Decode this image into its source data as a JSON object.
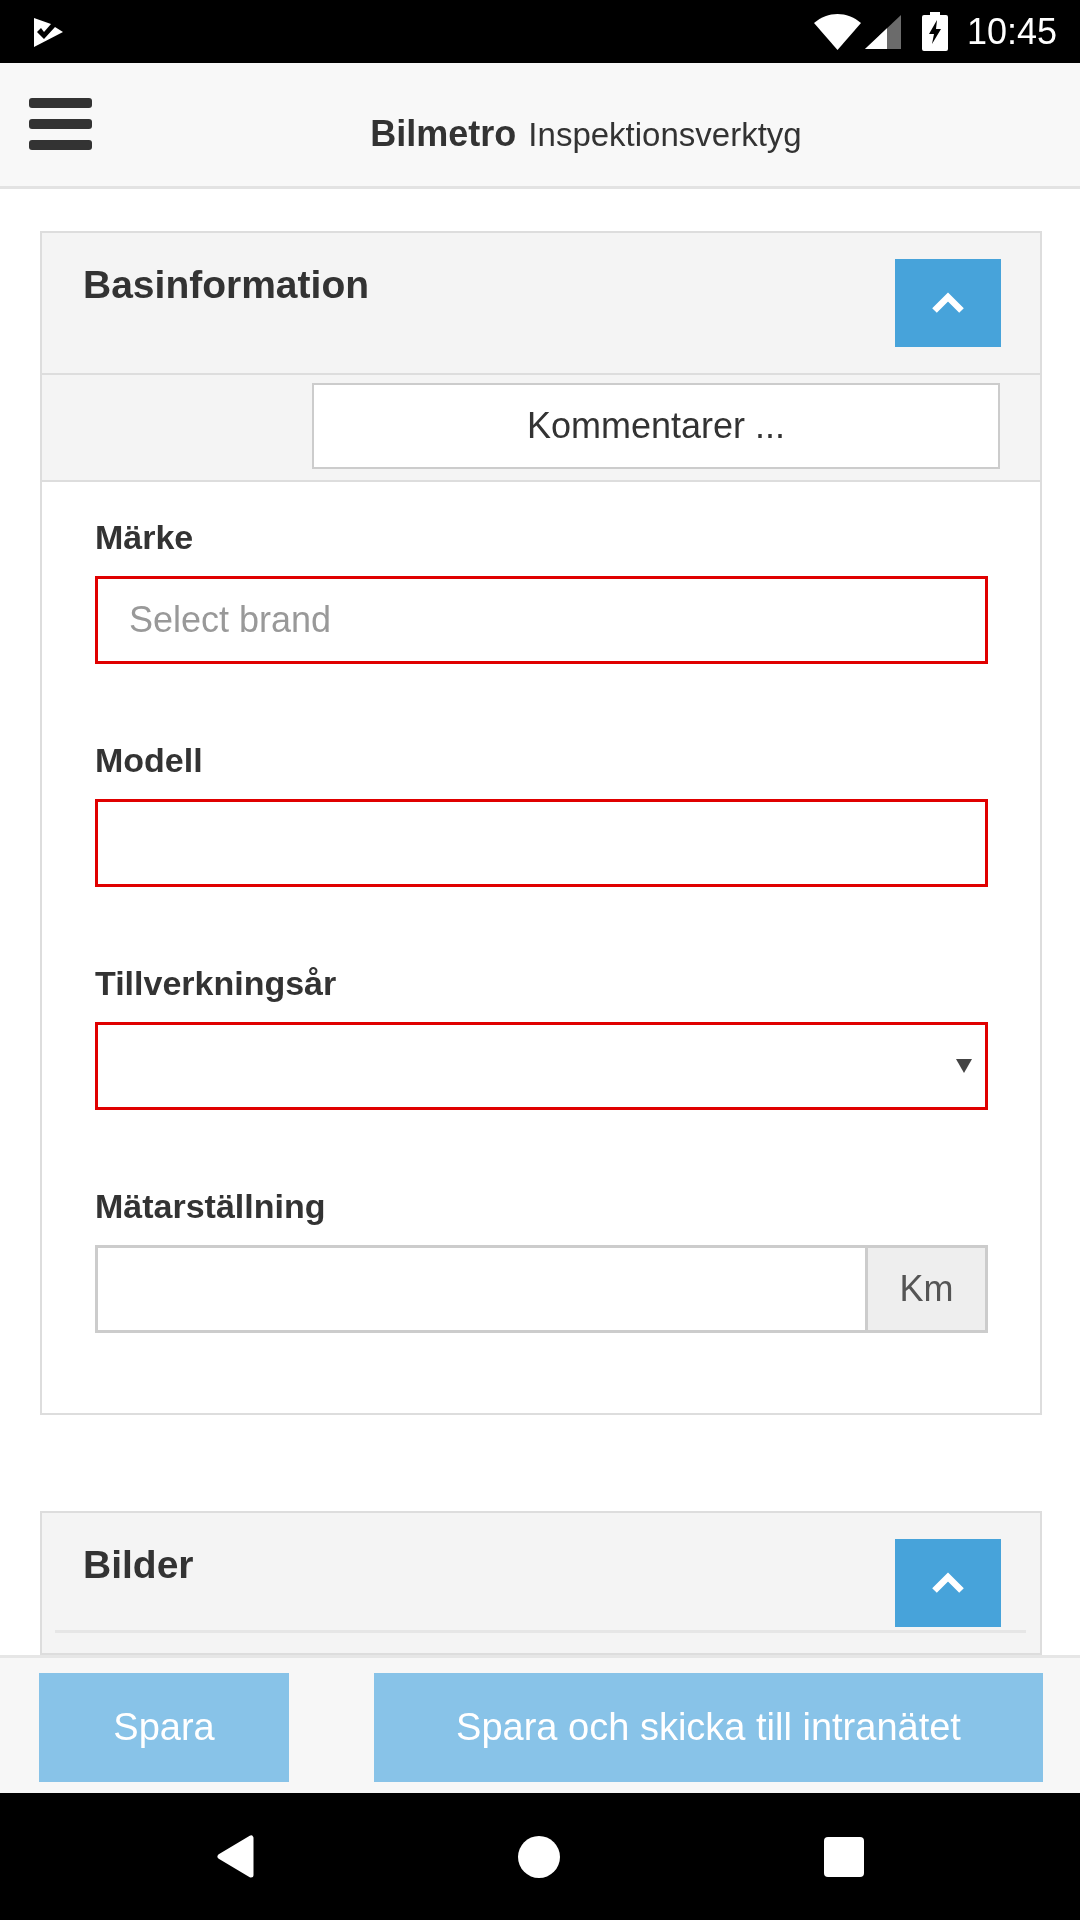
{
  "status_bar": {
    "time": "10:45"
  },
  "app_bar": {
    "brand": "Bilmetro",
    "title": "Inspektionsverktyg"
  },
  "sections": [
    {
      "title": "Basinformation",
      "expanded": true,
      "comments_button": "Kommentarer ...",
      "fields": [
        {
          "kind": "text",
          "label": "Märke",
          "placeholder": "Select brand",
          "invalid": true
        },
        {
          "kind": "text",
          "label": "Modell",
          "invalid": true
        },
        {
          "kind": "select",
          "label": "Tillverkningsår",
          "invalid": true
        },
        {
          "kind": "unit",
          "label": "Mätarställning",
          "unit": "Km",
          "invalid": false
        }
      ]
    },
    {
      "title": "Bilder",
      "expanded": true
    }
  ],
  "actions": [
    {
      "label": "Spara",
      "disabled": true
    },
    {
      "label": "Spara och skicka till intranätet",
      "disabled": true
    }
  ]
}
